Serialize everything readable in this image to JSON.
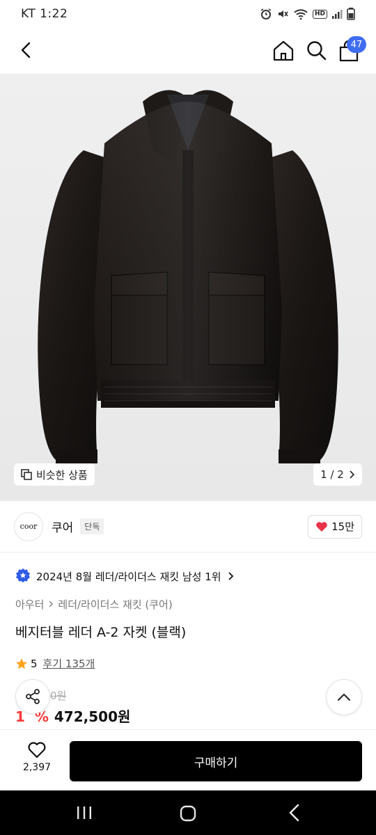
{
  "status_bar": {
    "carrier_time": "KT 1:22",
    "network_label": "HD"
  },
  "header": {
    "cart_count": "47"
  },
  "gallery": {
    "similar_label": "비슷한 상품",
    "page_indicator": "1 / 2"
  },
  "brand": {
    "logo_text": "coor",
    "name": "쿠어",
    "exclusive_tag": "단독",
    "likes": "15만"
  },
  "ranking": {
    "text": "2024년 8월 레더/라이더스 재킷 남성 1위"
  },
  "breadcrumb": {
    "category": "아우터",
    "subcategory": "레더/라이더스 재킷 (쿠어)"
  },
  "product": {
    "title": "베지터블 레더 A-2 자켓 (블랙)",
    "rating": "5",
    "review_label": "후기 135개",
    "original_price_fragment": "0원",
    "discount_fragment": "1",
    "discount_suffix": "%",
    "sale_price": "472,500원"
  },
  "bottom_bar": {
    "wish_count": "2,397",
    "buy_label": "구매하기"
  },
  "colors": {
    "accent_blue": "#3f6cf0",
    "discount_red": "#ff3a3a",
    "heart_red": "#e8344a",
    "star_orange": "#ffa41b"
  }
}
